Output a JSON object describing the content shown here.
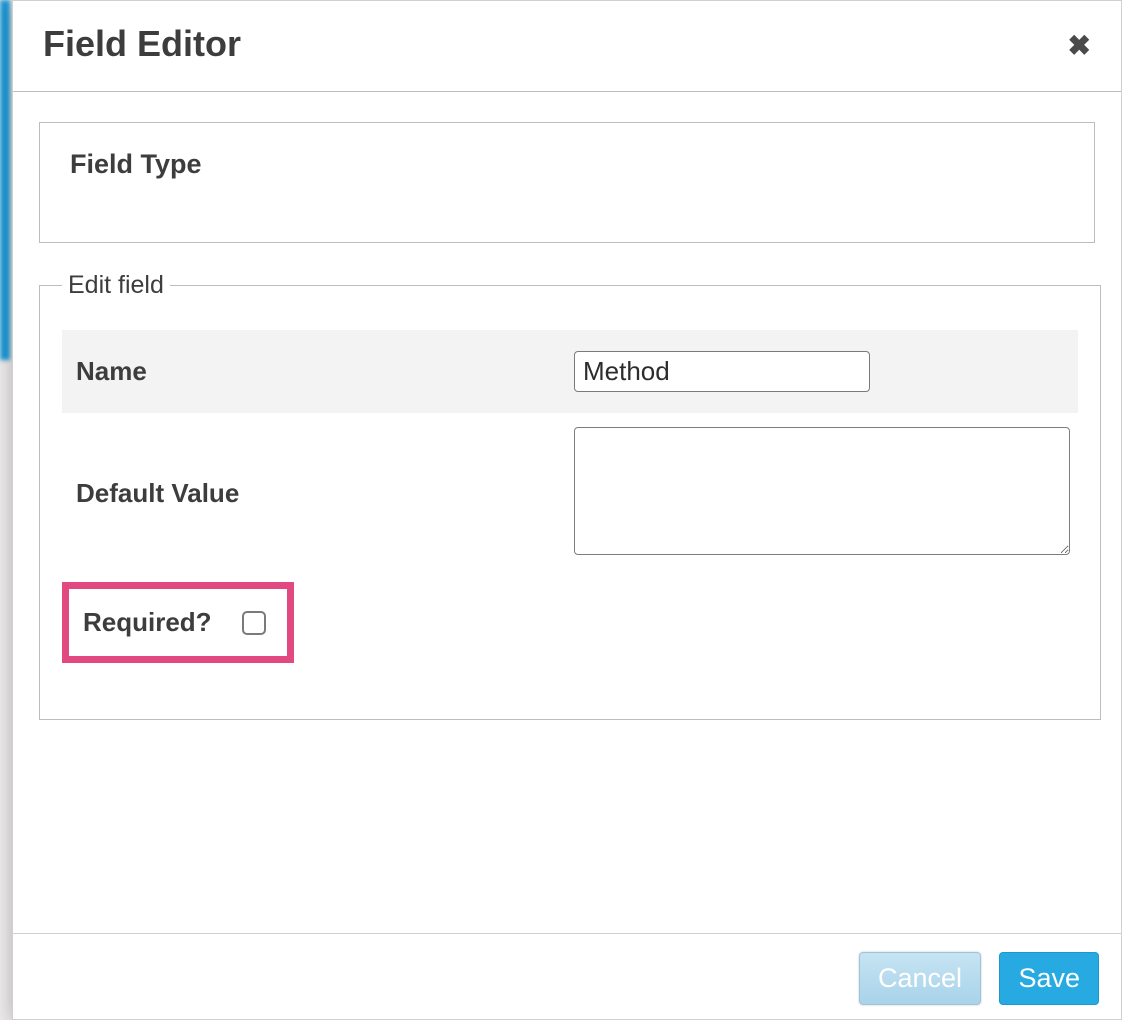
{
  "dialog": {
    "title": "Field Editor",
    "close_icon_glyph": "✖",
    "field_type_label": "Field Type",
    "edit_legend": "Edit field",
    "rows": {
      "name": {
        "label": "Name",
        "value": "Method"
      },
      "default_value": {
        "label": "Default Value",
        "value": ""
      },
      "required": {
        "label": "Required?",
        "checked": false
      }
    },
    "buttons": {
      "cancel": "Cancel",
      "save": "Save"
    }
  }
}
